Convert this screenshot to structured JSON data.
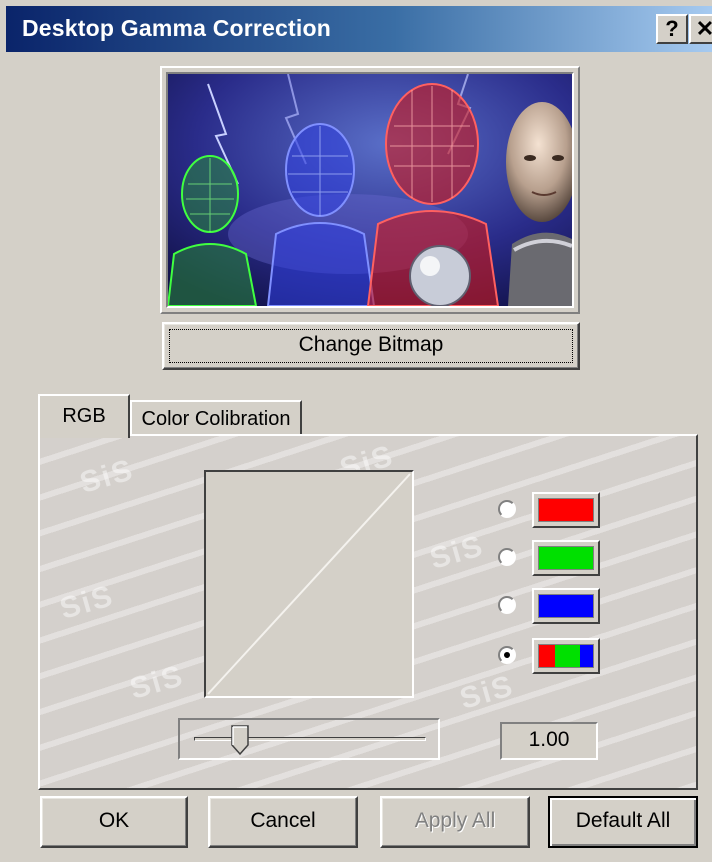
{
  "window": {
    "title": "Desktop Gamma Correction",
    "help_glyph": "?",
    "close_glyph": "✕"
  },
  "preview": {
    "change_bitmap_label": "Change Bitmap"
  },
  "tabs": [
    {
      "label": "RGB",
      "selected": true
    },
    {
      "label": "Color Colibration",
      "selected": false
    }
  ],
  "rgb_panel": {
    "channels": [
      {
        "name": "red",
        "color": "#ff0000",
        "selected": false
      },
      {
        "name": "green",
        "color": "#00e000",
        "selected": false
      },
      {
        "name": "blue",
        "color": "#0000ff",
        "selected": false
      },
      {
        "name": "all",
        "colors": [
          "#ff0000",
          "#00e000",
          "#0000ff"
        ],
        "selected": true
      }
    ],
    "gamma_value": "1.00",
    "slider_position": 0.2
  },
  "buttons": {
    "ok": "OK",
    "cancel": "Cancel",
    "apply_all": "Apply All",
    "default_all": "Default All"
  }
}
